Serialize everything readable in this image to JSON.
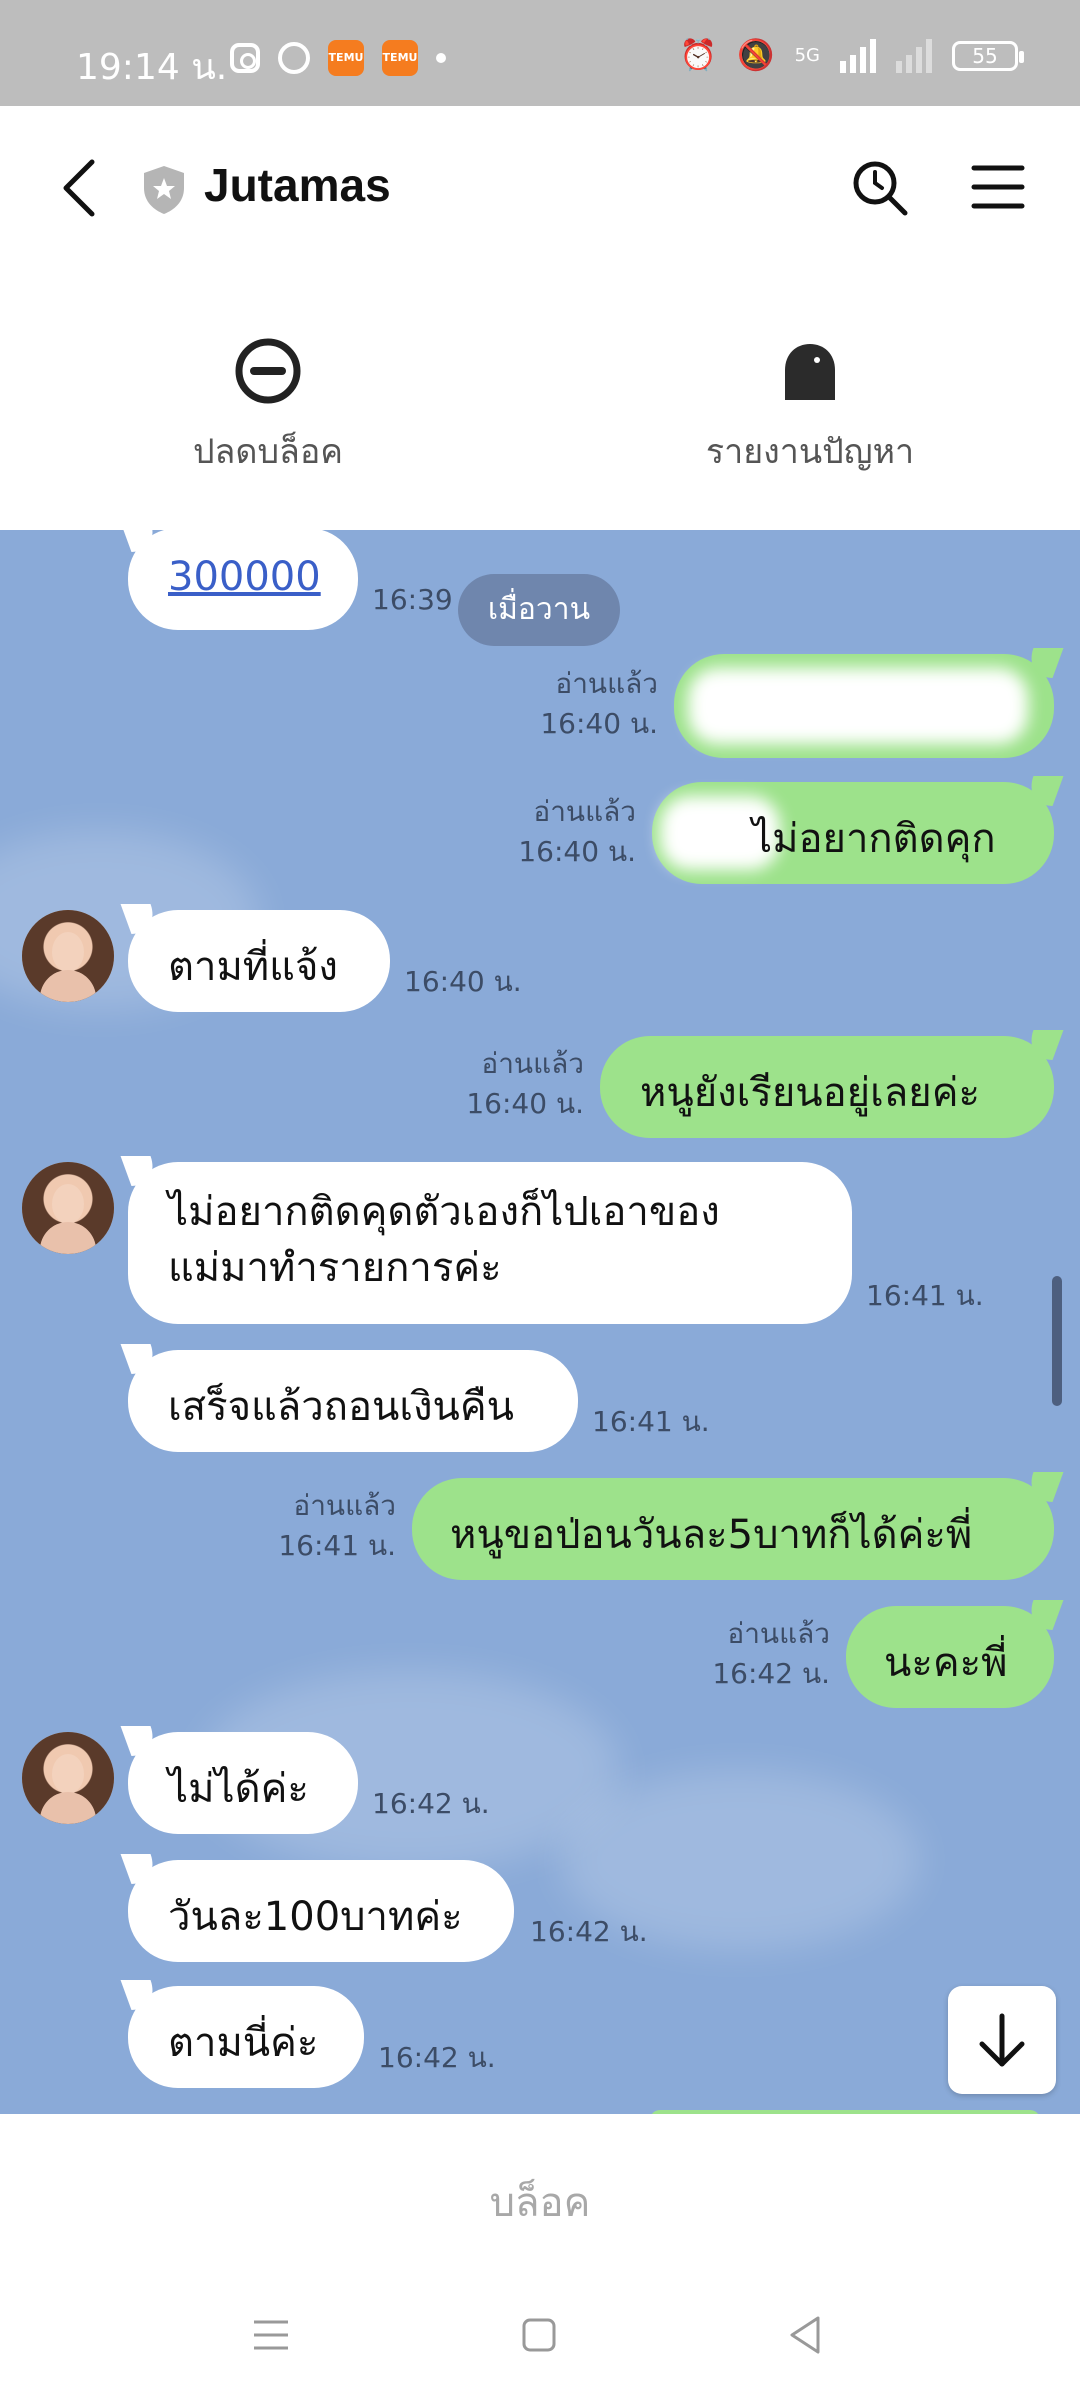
{
  "status_bar": {
    "time": "19:14 น.",
    "network": "5G",
    "battery": "55"
  },
  "header": {
    "title": "Jutamas"
  },
  "actions": {
    "unblock": "ปลดบล็อค",
    "report": "รายงานปัญหา"
  },
  "chat": {
    "date_divider": "เมื่อวาน",
    "read_label": "อ่านแล้ว",
    "messages": [
      {
        "dir": "in",
        "text": "300000",
        "time": "16:39 น."
      },
      {
        "dir": "out",
        "text": "",
        "time": "16:40 น."
      },
      {
        "dir": "out",
        "text": "ไม่อยากติดคุก",
        "time": "16:40 น."
      },
      {
        "dir": "in",
        "text": "ตามที่แจ้ง",
        "time": "16:40 น."
      },
      {
        "dir": "out",
        "text": "หนูยังเรียนอยู่เลยค่ะ",
        "time": "16:40 น."
      },
      {
        "dir": "in",
        "text": "ไม่อยากติดคุดตัวเองก็ไปเอาของ",
        "text2": "แม่มาทำรายการค่ะ",
        "time": "16:41 น."
      },
      {
        "dir": "in",
        "text": "เสร็จแล้วถอนเงินคืน",
        "time": "16:41 น."
      },
      {
        "dir": "out",
        "text": "หนูขอป่อนวันละ5บาทก็ได้ค่ะพี่",
        "time": "16:41 น."
      },
      {
        "dir": "out",
        "text": "นะคะพี่",
        "time": "16:42 น."
      },
      {
        "dir": "in",
        "text": "ไม่ได้ค่ะ",
        "time": "16:42 น."
      },
      {
        "dir": "in",
        "text": "วันละ100บาทค่ะ",
        "time": "16:42 น."
      },
      {
        "dir": "in",
        "text": "ตามนี่ค่ะ",
        "time": "16:42 น."
      }
    ]
  },
  "bottom": {
    "block": "บล็อค"
  },
  "icons": {
    "back": "chevron-left-icon",
    "shield": "shield-star-icon",
    "search": "search-history-icon",
    "menu": "hamburger-menu-icon",
    "unblock": "minus-circle-icon",
    "report": "bell-icon",
    "scroll_down": "arrow-down-icon"
  },
  "colors": {
    "chat_bg": "#8aaad8",
    "bubble_out": "#9de28b",
    "bubble_in": "#ffffff",
    "date_pill": "#6f86ad"
  }
}
